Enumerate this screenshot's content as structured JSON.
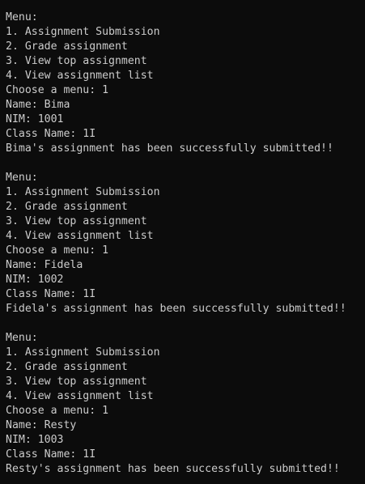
{
  "terminal": {
    "lines": [
      "Menu:",
      "1. Assignment Submission",
      "2. Grade assignment",
      "3. View top assignment",
      "4. View assignment list",
      "Choose a menu: 1",
      "Name: Bima",
      "NIM: 1001",
      "Class Name: 1I",
      "Bima's assignment has been successfully submitted!!",
      "",
      "Menu:",
      "1. Assignment Submission",
      "2. Grade assignment",
      "3. View top assignment",
      "4. View assignment list",
      "Choose a menu: 1",
      "Name: Fidela",
      "NIM: 1002",
      "Class Name: 1I",
      "Fidela's assignment has been successfully submitted!!",
      "",
      "Menu:",
      "1. Assignment Submission",
      "2. Grade assignment",
      "3. View top assignment",
      "4. View assignment list",
      "Choose a menu: 1",
      "Name: Resty",
      "NIM: 1003",
      "Class Name: 1I",
      "Resty's assignment has been successfully submitted!!"
    ]
  }
}
